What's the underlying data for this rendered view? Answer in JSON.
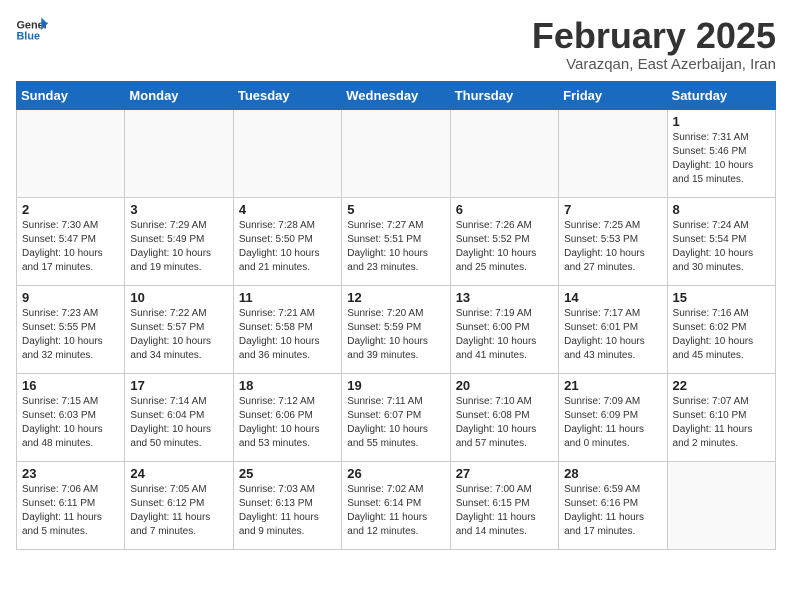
{
  "header": {
    "logo_general": "General",
    "logo_blue": "Blue",
    "month_title": "February 2025",
    "location": "Varazqan, East Azerbaijan, Iran"
  },
  "weekdays": [
    "Sunday",
    "Monday",
    "Tuesday",
    "Wednesday",
    "Thursday",
    "Friday",
    "Saturday"
  ],
  "weeks": [
    [
      {
        "day": "",
        "info": ""
      },
      {
        "day": "",
        "info": ""
      },
      {
        "day": "",
        "info": ""
      },
      {
        "day": "",
        "info": ""
      },
      {
        "day": "",
        "info": ""
      },
      {
        "day": "",
        "info": ""
      },
      {
        "day": "1",
        "info": "Sunrise: 7:31 AM\nSunset: 5:46 PM\nDaylight: 10 hours\nand 15 minutes."
      }
    ],
    [
      {
        "day": "2",
        "info": "Sunrise: 7:30 AM\nSunset: 5:47 PM\nDaylight: 10 hours\nand 17 minutes."
      },
      {
        "day": "3",
        "info": "Sunrise: 7:29 AM\nSunset: 5:49 PM\nDaylight: 10 hours\nand 19 minutes."
      },
      {
        "day": "4",
        "info": "Sunrise: 7:28 AM\nSunset: 5:50 PM\nDaylight: 10 hours\nand 21 minutes."
      },
      {
        "day": "5",
        "info": "Sunrise: 7:27 AM\nSunset: 5:51 PM\nDaylight: 10 hours\nand 23 minutes."
      },
      {
        "day": "6",
        "info": "Sunrise: 7:26 AM\nSunset: 5:52 PM\nDaylight: 10 hours\nand 25 minutes."
      },
      {
        "day": "7",
        "info": "Sunrise: 7:25 AM\nSunset: 5:53 PM\nDaylight: 10 hours\nand 27 minutes."
      },
      {
        "day": "8",
        "info": "Sunrise: 7:24 AM\nSunset: 5:54 PM\nDaylight: 10 hours\nand 30 minutes."
      }
    ],
    [
      {
        "day": "9",
        "info": "Sunrise: 7:23 AM\nSunset: 5:55 PM\nDaylight: 10 hours\nand 32 minutes."
      },
      {
        "day": "10",
        "info": "Sunrise: 7:22 AM\nSunset: 5:57 PM\nDaylight: 10 hours\nand 34 minutes."
      },
      {
        "day": "11",
        "info": "Sunrise: 7:21 AM\nSunset: 5:58 PM\nDaylight: 10 hours\nand 36 minutes."
      },
      {
        "day": "12",
        "info": "Sunrise: 7:20 AM\nSunset: 5:59 PM\nDaylight: 10 hours\nand 39 minutes."
      },
      {
        "day": "13",
        "info": "Sunrise: 7:19 AM\nSunset: 6:00 PM\nDaylight: 10 hours\nand 41 minutes."
      },
      {
        "day": "14",
        "info": "Sunrise: 7:17 AM\nSunset: 6:01 PM\nDaylight: 10 hours\nand 43 minutes."
      },
      {
        "day": "15",
        "info": "Sunrise: 7:16 AM\nSunset: 6:02 PM\nDaylight: 10 hours\nand 45 minutes."
      }
    ],
    [
      {
        "day": "16",
        "info": "Sunrise: 7:15 AM\nSunset: 6:03 PM\nDaylight: 10 hours\nand 48 minutes."
      },
      {
        "day": "17",
        "info": "Sunrise: 7:14 AM\nSunset: 6:04 PM\nDaylight: 10 hours\nand 50 minutes."
      },
      {
        "day": "18",
        "info": "Sunrise: 7:12 AM\nSunset: 6:06 PM\nDaylight: 10 hours\nand 53 minutes."
      },
      {
        "day": "19",
        "info": "Sunrise: 7:11 AM\nSunset: 6:07 PM\nDaylight: 10 hours\nand 55 minutes."
      },
      {
        "day": "20",
        "info": "Sunrise: 7:10 AM\nSunset: 6:08 PM\nDaylight: 10 hours\nand 57 minutes."
      },
      {
        "day": "21",
        "info": "Sunrise: 7:09 AM\nSunset: 6:09 PM\nDaylight: 11 hours\nand 0 minutes."
      },
      {
        "day": "22",
        "info": "Sunrise: 7:07 AM\nSunset: 6:10 PM\nDaylight: 11 hours\nand 2 minutes."
      }
    ],
    [
      {
        "day": "23",
        "info": "Sunrise: 7:06 AM\nSunset: 6:11 PM\nDaylight: 11 hours\nand 5 minutes."
      },
      {
        "day": "24",
        "info": "Sunrise: 7:05 AM\nSunset: 6:12 PM\nDaylight: 11 hours\nand 7 minutes."
      },
      {
        "day": "25",
        "info": "Sunrise: 7:03 AM\nSunset: 6:13 PM\nDaylight: 11 hours\nand 9 minutes."
      },
      {
        "day": "26",
        "info": "Sunrise: 7:02 AM\nSunset: 6:14 PM\nDaylight: 11 hours\nand 12 minutes."
      },
      {
        "day": "27",
        "info": "Sunrise: 7:00 AM\nSunset: 6:15 PM\nDaylight: 11 hours\nand 14 minutes."
      },
      {
        "day": "28",
        "info": "Sunrise: 6:59 AM\nSunset: 6:16 PM\nDaylight: 11 hours\nand 17 minutes."
      },
      {
        "day": "",
        "info": ""
      }
    ]
  ]
}
